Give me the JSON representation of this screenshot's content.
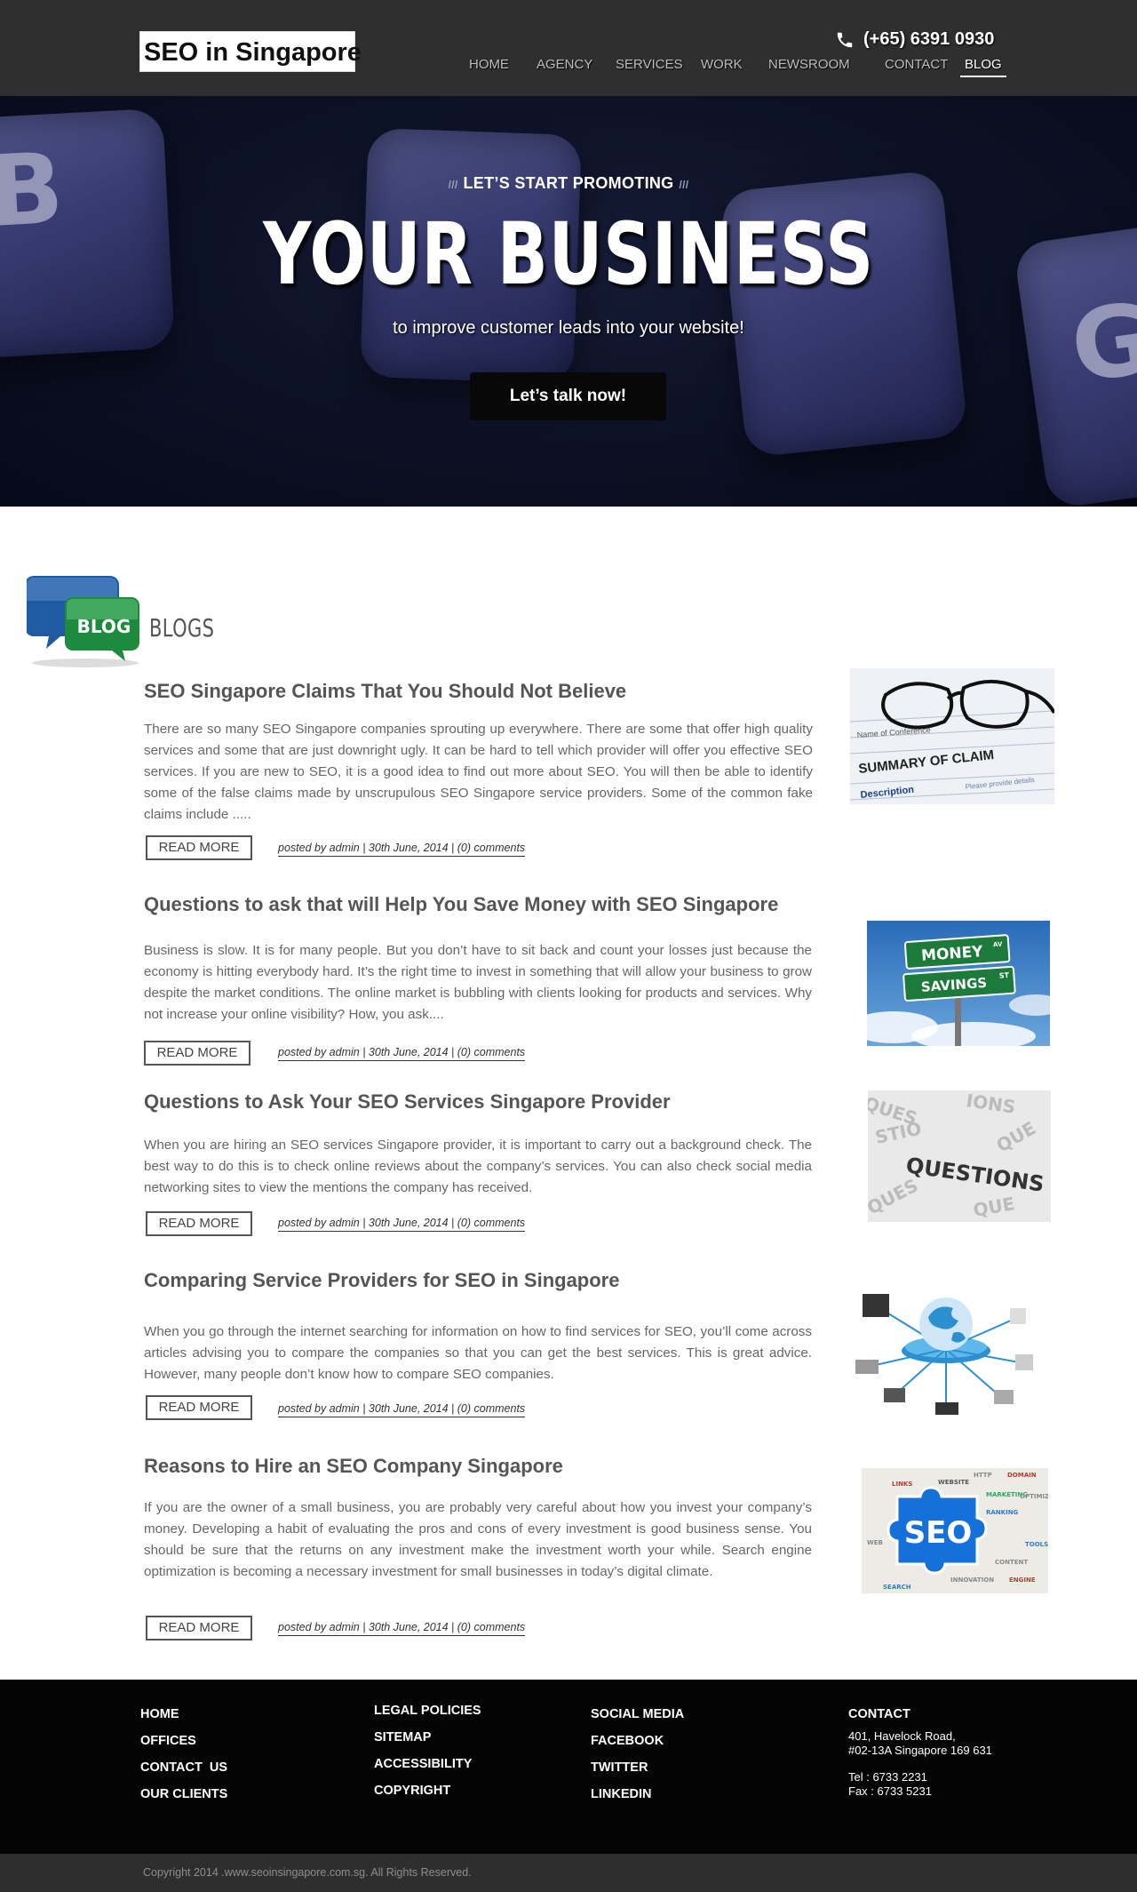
{
  "header": {
    "logo": "SEO in Singapore",
    "phone": "(+65) 6391 0930",
    "nav": [
      {
        "label": "HOME"
      },
      {
        "label": "AGENCY"
      },
      {
        "label": "SERVICES"
      },
      {
        "label": "WORK"
      },
      {
        "label": "NEWSROOM"
      },
      {
        "label": "CONTACT"
      },
      {
        "label": "BLOG",
        "active": true
      }
    ]
  },
  "hero": {
    "eyebrow": "LET’S START PROMOTING",
    "title": "YOUR BUSINESS",
    "subtitle": "to improve customer leads into your website!",
    "cta": "Let’s talk now!",
    "keys": [
      "B",
      "G"
    ]
  },
  "blogs": {
    "heading": "BLOGS",
    "icon_label": "BLOG",
    "posts": [
      {
        "title": "SEO Singapore Claims That You Should Not Believe",
        "body": "There are so many SEO Singapore companies sprouting up everywhere. There are some that offer high quality services and some that are just downright ugly. It can be hard to tell which provider will offer you effective SEO services. If you are new to SEO, it is a good idea to find out more about SEO. You will then be able to identify some of the false claims made by unscrupulous SEO Singapore service providers. Some of the common fake claims include .....",
        "read_more": "READ MORE",
        "meta": "posted by admin | 30th June, 2014 | (0) comments",
        "image_text": [
          "SUMMARY OF CLAIM",
          "Description",
          "Name of Conference",
          "Please provide details"
        ]
      },
      {
        "title": "Questions to ask that will Help You Save Money with SEO Singapore",
        "body": "Business is slow. It is for many people. But you don’t have to sit back and count your losses just because the economy is hitting everybody hard. It’s the right time to invest in something that will allow your business to grow despite the market conditions. The online market is bubbling with clients looking for products and services. Why not increase your online visibility? How, you ask....",
        "read_more": "READ MORE",
        "meta": "posted by admin | 30th June, 2014 | (0) comments",
        "image_text": [
          "MONEY",
          "AV",
          "SAVINGS",
          "ST"
        ]
      },
      {
        "title": "Questions to Ask Your SEO Services Singapore Provider",
        "body": "When you are hiring an SEO services Singapore provider, it is important to carry out a background check. The best way to do this is to check online reviews about the company’s services. You can also check social media networking sites to view the mentions the company has received.",
        "read_more": "READ MORE",
        "meta": "posted by admin | 30th June, 2014 | (0) comments",
        "image_text": [
          "QUESTIONS"
        ]
      },
      {
        "title": "Comparing Service Providers for SEO in Singapore",
        "body": "When you go through the internet searching for information on how to find services for SEO, you’ll come across articles advising you to compare the companies so that you can get the best services. This is great advice. However, many people don’t know how to compare SEO companies.",
        "read_more": "READ MORE",
        "meta": "posted by admin | 30th June, 2014 | (0) comments",
        "image_text": []
      },
      {
        "title": "Reasons to Hire an SEO Company Singapore",
        "body": "If you are the owner of a small business, you are probably very careful about how you invest your company’s money. Developing a habit of evaluating the pros and cons of every investment is good business sense. You should be sure that the returns on any investment make the investment worth your while. Search engine optimization is becoming a necessary investment for small businesses in today’s digital climate.",
        "read_more": "READ MORE",
        "meta": "posted by admin | 30th June, 2014 | (0) comments",
        "image_text": [
          "SEO",
          "LINKS",
          "WEBSITE",
          "HTTP",
          "DOMAIN",
          "MARKETING",
          "OPTIMIZE",
          "RANKING",
          "CONTENT",
          "SEARCH",
          "INNOVATION",
          "ENGINE",
          "WEB",
          "TOOLS"
        ]
      }
    ]
  },
  "footer": {
    "col1": [
      "HOME",
      "OFFICES",
      "CONTACT  US",
      "OUR CLIENTS"
    ],
    "col2": [
      "LEGAL POLICIES",
      "SITEMAP",
      "ACCESSIBILITY",
      "COPYRIGHT"
    ],
    "col3": [
      "SOCIAL MEDIA",
      "FACEBOOK",
      "TWITTER",
      "LINKEDIN"
    ],
    "contact": {
      "heading": "CONTACT",
      "address1": "401, Havelock Road,",
      "address2": "#02-13A Singapore 169 631",
      "tel": "Tel : 6733 2231",
      "fax": "Fax : 6733 5231"
    },
    "copyright": "Copyright 2014 .www.seoinsingapore.com.sg. All Rights Reserved."
  },
  "colors": {
    "header_bg": "#2f2f2f",
    "footer_bg": "#040404",
    "copyright_bg": "#2e2e2e",
    "blog_bubble_blue": "#1f5aa3",
    "blog_bubble_green": "#1e8a3e"
  }
}
